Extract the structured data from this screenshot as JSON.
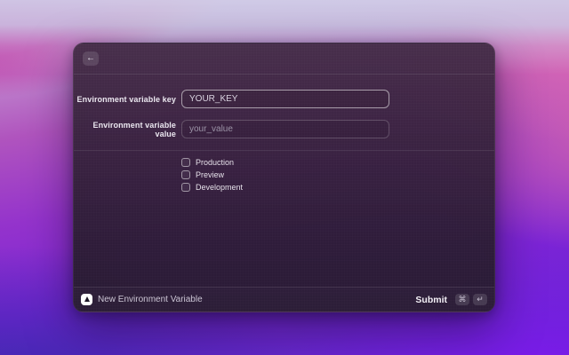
{
  "header": {
    "back_icon": "←"
  },
  "form": {
    "fields": [
      {
        "label": "Environment variable key",
        "value": "YOUR_KEY",
        "placeholder": ""
      },
      {
        "label": "Environment variable value",
        "value": "",
        "placeholder": "your_value"
      }
    ],
    "checkboxes": [
      {
        "label": "Production",
        "checked": false
      },
      {
        "label": "Preview",
        "checked": false
      },
      {
        "label": "Development",
        "checked": false
      }
    ]
  },
  "footer": {
    "app_icon": "vercel-triangle-icon",
    "title": "New Environment Variable",
    "submit_label": "Submit",
    "shortcut_keys": [
      "⌘",
      "↵"
    ]
  },
  "colors": {
    "wallpaper_magenta": "#c03ba8",
    "wallpaper_pink": "#e06bb2",
    "wallpaper_violet": "#8118f0",
    "wallpaper_indigo": "#3d28ae",
    "window_tint": "#32203a",
    "input_border_focused": "#bfb7c8",
    "vercel_icon_bg": "#ffffff",
    "vercel_triangle": "#1b1525"
  }
}
